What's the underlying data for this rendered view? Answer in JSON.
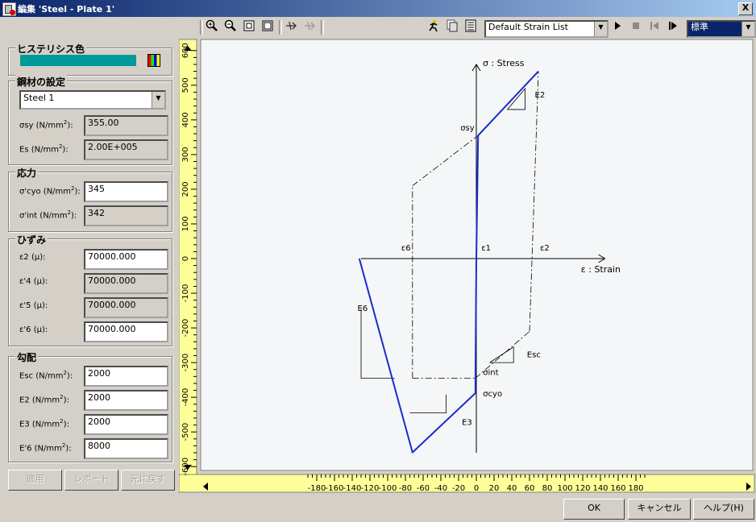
{
  "window": {
    "title": "編集 'Steel - Plate 1'",
    "close_label": "X"
  },
  "toolbar": {
    "strain_list": "Default Strain List",
    "style_select": "標準"
  },
  "hysteresis": {
    "title": "ヒステリシス色",
    "color": "#009999"
  },
  "material": {
    "title": "鋼材の設定",
    "select": "Steel 1",
    "sigma_sy_label": "σsy (N/mm",
    "sigma_sy_value": "355.00",
    "es_label": "Es (N/mm",
    "es_value": "2.00E+005"
  },
  "stress": {
    "title": "応力",
    "s_cyo_label": "σ'cyo (N/mm",
    "s_cyo_value": "345",
    "s_int_label": "σ'int (N/mm",
    "s_int_value": "342"
  },
  "strain": {
    "title": "ひずみ",
    "e2_label": "ε2 (μ):",
    "e2_value": "70000.000",
    "e4_label": "ε'4 (μ):",
    "e4_value": "70000.000",
    "e5_label": "ε'5 (μ):",
    "e5_value": "70000.000",
    "e6_label": "ε'6 (μ):",
    "e6_value": "70000.000"
  },
  "slope": {
    "title": "勾配",
    "esc_label": "Esc (N/mm",
    "esc_value": "2000",
    "e2_label": "E2 (N/mm",
    "e2_value": "2000",
    "e3_label": "E3 (N/mm",
    "e3_value": "2000",
    "e6_label": "E'6 (N/mm",
    "e6_value": "8000"
  },
  "actions": {
    "apply": "適用",
    "report": "レポート",
    "revert": "元に戻す"
  },
  "dialog": {
    "ok": "OK",
    "cancel": "キャンセル",
    "help": "ヘルプ(H)"
  },
  "chart_data": {
    "type": "line",
    "x_axis_title": "ε : Strain",
    "y_axis_title": "σ : Stress",
    "xlim": [
      -190,
      190
    ],
    "ylim": [
      -600,
      600
    ],
    "x_ticks": [
      -180,
      -160,
      -140,
      -120,
      -100,
      -80,
      -60,
      -40,
      -20,
      0,
      20,
      40,
      60,
      80,
      100,
      120,
      140,
      160,
      180
    ],
    "y_ticks": [
      600,
      500,
      400,
      300,
      200,
      100,
      0,
      -100,
      -200,
      -300,
      -400,
      -500,
      -600
    ],
    "series": [
      {
        "style": "solid",
        "color": "#1a2cc8",
        "points": [
          [
            -132,
            0
          ],
          [
            -72,
            -559
          ],
          [
            -1,
            -388
          ],
          [
            -1,
            -345
          ],
          [
            0,
            0
          ],
          [
            2,
            355
          ],
          [
            70,
            540
          ]
        ]
      }
    ],
    "annotations": [
      {
        "text": "σsy",
        "x": 2,
        "y": 355
      },
      {
        "text": "σint",
        "x": 2,
        "y": -345
      },
      {
        "text": "σcyo",
        "x": 2,
        "y": -388
      },
      {
        "text": "ε6",
        "x": -72,
        "y": 0
      },
      {
        "text": "ε1",
        "x": 2,
        "y": 0
      },
      {
        "text": "ε2",
        "x": 70,
        "y": 0
      },
      {
        "text": "E2",
        "x": 55,
        "y": 460
      },
      {
        "text": "E6",
        "x": -125,
        "y": -170
      },
      {
        "text": "E3",
        "x": -20,
        "y": -470
      },
      {
        "text": "Esc",
        "x": 48,
        "y": -280
      }
    ]
  }
}
